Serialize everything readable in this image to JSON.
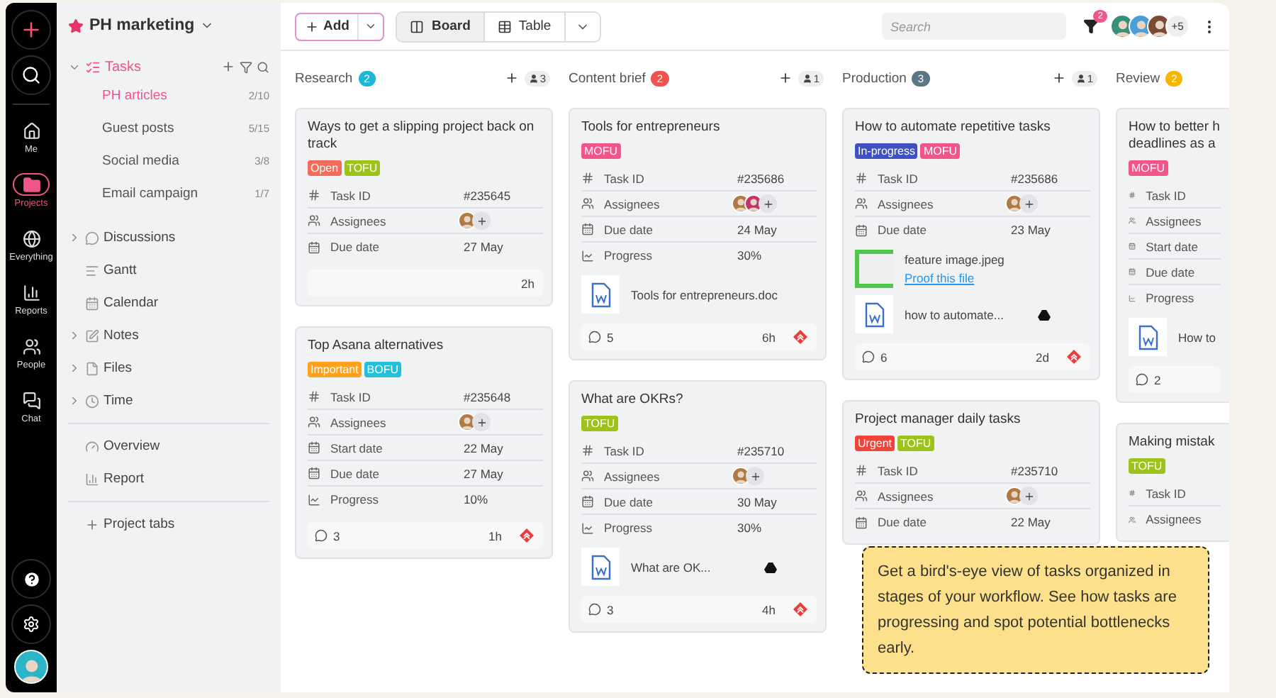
{
  "rail": {
    "items": [
      {
        "label": "Me",
        "selected": false
      },
      {
        "label": "Projects",
        "selected": true
      },
      {
        "label": "Everything",
        "selected": false
      },
      {
        "label": "Reports",
        "selected": false
      },
      {
        "label": "People",
        "selected": false
      },
      {
        "label": "Chat",
        "selected": false
      }
    ]
  },
  "sidebar": {
    "project": "PH marketing",
    "tasks": {
      "label": "Tasks",
      "expanded": true,
      "items": [
        {
          "label": "PH articles",
          "count": "2/10",
          "selected": true
        },
        {
          "label": "Guest posts",
          "count": "5/15",
          "selected": false
        },
        {
          "label": "Social media",
          "count": "3/8",
          "selected": false
        },
        {
          "label": "Email campaign",
          "count": "1/7",
          "selected": false
        }
      ]
    },
    "nav": [
      {
        "label": "Discussions",
        "expandable": true
      },
      {
        "label": "Gantt",
        "expandable": false
      },
      {
        "label": "Calendar",
        "expandable": false
      },
      {
        "label": "Notes",
        "expandable": true
      },
      {
        "label": "Files",
        "expandable": true
      },
      {
        "label": "Time",
        "expandable": true
      }
    ],
    "views": [
      {
        "label": "Overview"
      },
      {
        "label": "Report"
      }
    ],
    "add_tab": "Project tabs"
  },
  "toolbar": {
    "add": "Add",
    "views": [
      {
        "label": "Board",
        "selected": true
      },
      {
        "label": "Table",
        "selected": false
      }
    ],
    "search": {
      "placeholder": "Search"
    },
    "filter_badge": "2",
    "more_people": "+5"
  },
  "columns": [
    {
      "name": "Research",
      "count": "2",
      "color": "#1fb6d6",
      "people": "3",
      "cards": [
        {
          "title": "Ways to get a slipping project back on track",
          "tags": [
            {
              "label": "Open",
              "color": "#f36b5a"
            },
            {
              "label": "TOFU",
              "color": "#9cc31b"
            }
          ],
          "rows": [
            {
              "kind": "id",
              "label": "Task ID",
              "value": "#235645"
            },
            {
              "kind": "people",
              "label": "Assignees",
              "avatars": [
                {
                  "kind": "photo"
                }
              ]
            },
            {
              "kind": "date",
              "label": "Due date",
              "value": "27 May"
            }
          ],
          "footer": {
            "time": "2h",
            "flagged": false
          }
        },
        {
          "title": "Top Asana alternatives",
          "tags": [
            {
              "label": "Important",
              "color": "#ffa11c"
            },
            {
              "label": "BOFU",
              "color": "#22c1d9"
            }
          ],
          "rows": [
            {
              "kind": "id",
              "label": "Task ID",
              "value": "#235648"
            },
            {
              "kind": "people",
              "label": "Assignees",
              "avatars": [
                {
                  "kind": "photo"
                }
              ]
            },
            {
              "kind": "date",
              "label": "Start date",
              "value": "22 May"
            },
            {
              "kind": "date",
              "label": "Due date",
              "value": "27 May"
            },
            {
              "kind": "progress",
              "label": "Progress",
              "value": "10%"
            }
          ],
          "footer": {
            "comments": "3",
            "time": "1h",
            "flagged": true
          }
        }
      ]
    },
    {
      "name": "Content brief",
      "count": "2",
      "color": "#f0524f",
      "people": "1",
      "cards": [
        {
          "title": "Tools for entrepreneurs",
          "tags": [
            {
              "label": "MOFU",
              "color": "#f0558c"
            }
          ],
          "rows": [
            {
              "kind": "id",
              "label": "Task ID",
              "value": "#235686"
            },
            {
              "kind": "people",
              "label": "Assignees",
              "avatars": [
                {
                  "kind": "photo"
                },
                {
                  "kind": "photo"
                }
              ]
            },
            {
              "kind": "date",
              "label": "Due date",
              "value": "24 May"
            },
            {
              "kind": "progress",
              "label": "Progress",
              "value": "30%"
            }
          ],
          "files": [
            {
              "kind": "doc",
              "name": "Tools for entrepreneurs.doc"
            }
          ],
          "footer": {
            "comments": "5",
            "time": "6h",
            "flagged": true
          }
        },
        {
          "title": "What are OKRs?",
          "tags": [
            {
              "label": "TOFU",
              "color": "#9cc31b"
            }
          ],
          "rows": [
            {
              "kind": "id",
              "label": "Task ID",
              "value": "#235710"
            },
            {
              "kind": "people",
              "label": "Assignees",
              "avatars": [
                {
                  "kind": "photo"
                }
              ]
            },
            {
              "kind": "date",
              "label": "Due date",
              "value": "30 May"
            },
            {
              "kind": "progress",
              "label": "Progress",
              "value": "30%"
            }
          ],
          "files": [
            {
              "kind": "doc",
              "name": "What are OK...",
              "drive": true
            }
          ],
          "footer": {
            "comments": "3",
            "time": "4h",
            "flagged": true
          }
        }
      ]
    },
    {
      "name": "Production",
      "count": "3",
      "color": "#5b7785",
      "people": "1",
      "cards": [
        {
          "title": "How to automate repetitive tasks",
          "tags": [
            {
              "label": "In-progress",
              "color": "#3f51c2"
            },
            {
              "label": "MOFU",
              "color": "#f0558c"
            }
          ],
          "rows": [
            {
              "kind": "id",
              "label": "Task ID",
              "value": "#235686"
            },
            {
              "kind": "people",
              "label": "Assignees",
              "avatars": [
                {
                  "kind": "photo"
                }
              ]
            },
            {
              "kind": "date",
              "label": "Due date",
              "value": "23 May"
            }
          ],
          "files": [
            {
              "kind": "image",
              "name": "feature image.jpeg",
              "link": "Proof this file"
            },
            {
              "kind": "doc",
              "name": "how to automate...",
              "drive": true
            }
          ],
          "footer": {
            "comments": "6",
            "time": "2d",
            "flagged": true
          }
        },
        {
          "title": "Project manager daily tasks",
          "tags": [
            {
              "label": "Urgent",
              "color": "#f0433a"
            },
            {
              "label": "TOFU",
              "color": "#9cc31b"
            }
          ],
          "rows": [
            {
              "kind": "id",
              "label": "Task ID",
              "value": "#235710"
            },
            {
              "kind": "people",
              "label": "Assignees",
              "avatars": [
                {
                  "kind": "photo"
                }
              ]
            },
            {
              "kind": "date",
              "label": "Due date",
              "value": "22 May"
            }
          ]
        }
      ]
    },
    {
      "name": "Review",
      "count": "2",
      "color": "#f7b500",
      "cards": [
        {
          "title_lines": [
            "How to better h",
            "deadlines as a"
          ],
          "tags": [
            {
              "label": "MOFU",
              "color": "#f0558c"
            }
          ],
          "rows": [
            {
              "kind": "id",
              "label": "Task ID"
            },
            {
              "kind": "people",
              "label": "Assignees"
            },
            {
              "kind": "date",
              "label": "Start date"
            },
            {
              "kind": "date",
              "label": "Due date"
            },
            {
              "kind": "progress",
              "label": "Progress"
            }
          ],
          "files": [
            {
              "kind": "doc",
              "name": "How to"
            }
          ],
          "footer": {
            "comments": "2",
            "flagged": false
          }
        },
        {
          "title": "Making mistak",
          "tags": [
            {
              "label": "TOFU",
              "color": "#9cc31b"
            }
          ],
          "rows": [
            {
              "kind": "id",
              "label": "Task ID"
            },
            {
              "kind": "people",
              "label": "Assignees"
            }
          ]
        }
      ]
    }
  ],
  "tooltip": "Get a bird's-eye view of tasks organized in stages of your workflow. See how tasks are progressing and spot potential bottlenecks early."
}
